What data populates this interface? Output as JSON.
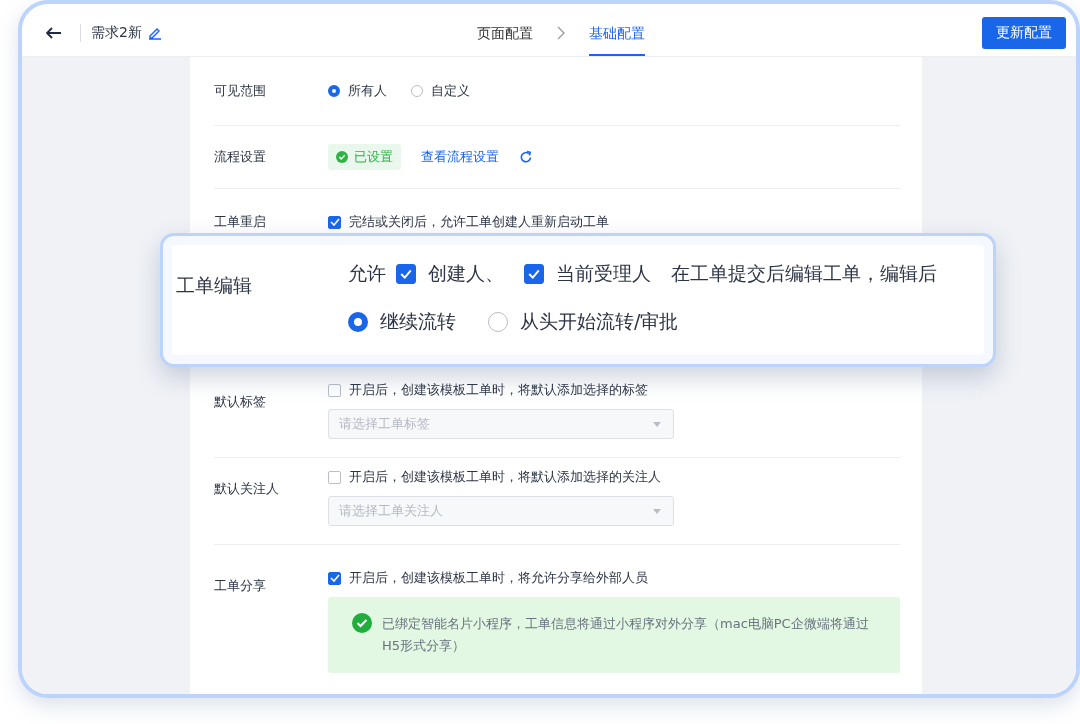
{
  "header": {
    "title": "需求2新",
    "steps": [
      {
        "label": "页面配置",
        "selected": false
      },
      {
        "label": "基础配置",
        "selected": true
      }
    ],
    "button": "更新配置"
  },
  "rows": [
    {
      "kind": "radio",
      "label": "可见范围",
      "options": [
        {
          "label": "所有人",
          "selected": true
        },
        {
          "label": "自定义",
          "selected": false
        }
      ]
    },
    {
      "kind": "status",
      "label": "流程设置",
      "badge": "已设置",
      "link": "查看流程设置"
    },
    {
      "kind": "checkbox",
      "label": "工单重启",
      "checked": true,
      "text": "完结或关闭后，允许工单创建人重新启动工单"
    },
    {
      "kind": "hidden"
    },
    {
      "kind": "select",
      "label": "默认标签",
      "checked": false,
      "text": "开启后，创建该模板工单时，将默认添加选择的标签",
      "placeholder": "请选择工单标签"
    },
    {
      "kind": "select",
      "label": "默认关注人",
      "checked": false,
      "text": "开启后，创建该模板工单时，将默认添加选择的关注人",
      "placeholder": "请选择工单关注人"
    },
    {
      "kind": "notice",
      "label": "工单分享",
      "checked": true,
      "text": "开启后，创建该模板工单时，将允许分享给外部人员",
      "notice": "已绑定智能名片小程序，工单信息将通过小程序对外分享（mac电脑PC企微端将通过H5形式分享）"
    }
  ],
  "callout": {
    "label": "工单编辑",
    "prefix": "允许",
    "checks": [
      {
        "label": "创建人、",
        "checked": true
      },
      {
        "label": "当前受理人",
        "checked": true
      }
    ],
    "suffix": "在工单提交后编辑工单，编辑后",
    "options": [
      {
        "label": "继续流转",
        "selected": true
      },
      {
        "label": "从头开始流转/审批",
        "selected": false
      }
    ]
  }
}
